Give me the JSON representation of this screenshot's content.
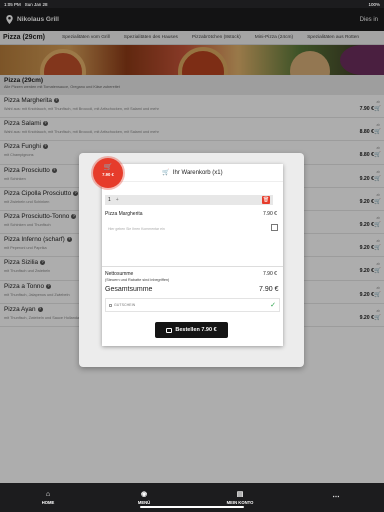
{
  "status": {
    "time": "1:05 PM",
    "date": "Sun Jan 28",
    "battery": "100%"
  },
  "header": {
    "store_name": "Nikolaus Grill",
    "language": "Dies in"
  },
  "categories": [
    {
      "label": "Pizza (29cm)"
    },
    {
      "label": "Spezialitäten vom Grill"
    },
    {
      "label": "Spezialitäten des Hauses"
    },
    {
      "label": "Pizzabrötchen (8stück)"
    },
    {
      "label": "Mini-Pizza (24cm)"
    },
    {
      "label": "Spezialitäten aus Rotten"
    }
  ],
  "section": {
    "title": "Pizza (29cm)",
    "description": "Alle Pizzen werden mit Tomatensauce, Oregano und Käse zubereitet"
  },
  "items": [
    {
      "name": "Pizza Margherita",
      "desc": "Wahl aus: mit Knoblauch, mit Thunfisch, mit Broccoli, mit Artischocken, mit Salami und mehr",
      "from": "ab",
      "price": "7.90 €"
    },
    {
      "name": "Pizza Salami",
      "desc": "Wahl aus: mit Knoblauch, mit Thunfisch, mit Broccoli, mit Artischocken, mit Salami und mehr",
      "from": "ab",
      "price": "8.80 €"
    },
    {
      "name": "Pizza Funghi",
      "desc": "mit Champignons",
      "from": "ab",
      "price": "8.80 €"
    },
    {
      "name": "Pizza Prosciutto",
      "desc": "mit Schinken",
      "from": "ab",
      "price": "9.20 €"
    },
    {
      "name": "Pizza Cipolla Prosciutto",
      "desc": "mit Zwiebeln und Schinken",
      "from": "ab",
      "price": "9.20 €"
    },
    {
      "name": "Pizza Prosciutto-Tonno",
      "desc": "mit Schinken und Thunfisch",
      "from": "ab",
      "price": "9.20 €"
    },
    {
      "name": "Pizza Inferno (scharf)",
      "desc": "mit Peperoni und Paprika",
      "from": "ab",
      "price": "9.20 €"
    },
    {
      "name": "Pizza Sizilia",
      "desc": "mit Thunfisch und Zwiebeln",
      "from": "ab",
      "price": "9.20 €"
    },
    {
      "name": "Pizza a Tonno",
      "desc": "mit Thunfisch, Jalapenos und Zwiebeln",
      "from": "ab",
      "price": "9.20 €"
    },
    {
      "name": "Pizza Ayan",
      "desc": "mit Thunfisch, Zwiebeln und Sauce Hollandaise",
      "from": "ab",
      "price": "9.20 €"
    }
  ],
  "cart": {
    "badge_price": "7.90 €",
    "title": "Ihr Warenkorb (x1)",
    "qty": "1",
    "plus": "+",
    "line_name": "Pizza Margherita",
    "line_price": "7.90 €",
    "note_placeholder": "Hier geben Sie Ihren Kommentar ein",
    "net_label": "Nettosumme",
    "net_price": "7.90 €",
    "net_sub": "(Steuern und Rabatte sind inbegriffen)",
    "total_label": "Gesamtsumme",
    "total_price": "7.90 €",
    "coupon_label": "GUTSCHEIN",
    "order_label": "Bestellen 7.90 €"
  },
  "tabs": [
    {
      "label": "HOME",
      "icon": "home-icon"
    },
    {
      "label": "MENÜ",
      "icon": "tag-icon"
    },
    {
      "label": "MEIN KONTO",
      "icon": "bag-icon"
    },
    {
      "label": "",
      "icon": "more-icon"
    }
  ]
}
